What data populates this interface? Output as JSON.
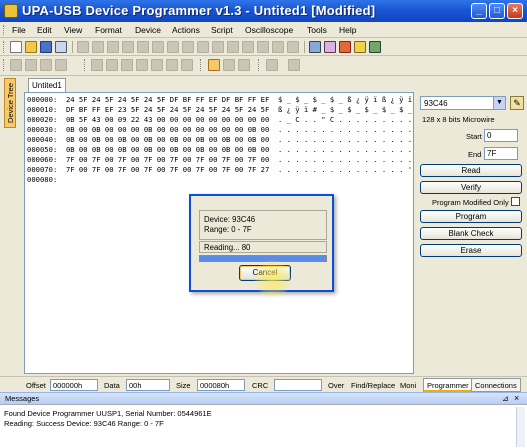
{
  "window": {
    "title": "UPA-USB Device Programmer v1.3 - Untited1 [Modified]"
  },
  "menubar": [
    "File",
    "Edit",
    "View",
    "Format",
    "Device",
    "Actions",
    "Script",
    "Oscilloscope",
    "Tools",
    "Help"
  ],
  "sidebar": {
    "tab_label": "Device Tree"
  },
  "document": {
    "tab": "Untited1",
    "hex_lines": [
      "000000:  24 5F 24 5F 24 5F 24 5F DF BF FF EF DF BF FF EF  $ _ $ _ $ _ $ _ ß ¿ ÿ ï ß ¿ ÿ ï",
      "000010:  DF BF FF EF 23 5F 24 5F 24 5F 24 5F 24 5F 24 5F  ß ¿ ÿ ï # _ $ _ $ _ $ _ $ _ $ _",
      "000020:  0B 5F 43 00 09 22 43 00 00 00 00 00 00 00 00 00  . _ C . . \" C . . . . . . . . .",
      "000030:  0B 00 0B 00 00 00 0B 00 00 00 00 00 00 00 0B 00  . . . . . . . . . . . . . . . .",
      "000040:  0B 00 0B 00 0B 00 0B 00 0B 00 0B 00 0B 00 0B 00  . . . . . . . . . . . . . . . .",
      "000050:  0B 00 0B 00 0B 00 0B 00 0B 00 0B 00 0B 00 0B 00  . . . . . . . . . . . . . . . .",
      "000060:  7F 00 7F 00 7F 00 7F 00 7F 00 7F 00 7F 00 7F 00  . . . . . . . . . . . . . . . .",
      "000070:  7F 00 7F 00 7F 00 7F 00 7F 00 7F 00 7F 00 7F 27  . . . . . . . . . . . . . . . '",
      "000080:"
    ]
  },
  "device_panel": {
    "chip": "93C46",
    "description": "128 x 8 bits Microwire",
    "start_label": "Start",
    "start_value": "0",
    "end_label": "End",
    "end_value": "7F",
    "read_button": "Read",
    "verify_button": "Verify",
    "program_modified_only": "Program Modified Only",
    "program_button": "Program",
    "blank_check_button": "Blank Check",
    "erase_button": "Erase"
  },
  "statusbar": {
    "offset_label": "Offset",
    "offset_value": "000000h",
    "data_label": "Data",
    "data_value": "00h",
    "size_label": "Size",
    "size_value": "000080h",
    "crc_label": "CRC",
    "over_label": "Over",
    "find_replace_label": "Find/Replace",
    "moni_label": "Moni",
    "tab_programmer": "Programmer",
    "tab_connections": "Connections"
  },
  "messages": {
    "header": "Messages",
    "lines": [
      "Found Device Programmer UUSP1, Serial Number: 0544961E",
      "Reading: Success  Device: 93C46 Range: 0 - 7F"
    ]
  },
  "dialog": {
    "device_line": "Device: 93C46",
    "range_line": "Range: 0 - 7F",
    "status_line": "Reading... 80",
    "progress": 1.0,
    "cancel_button": "Cancel"
  },
  "colors": {
    "titlebar": "#1a56d4",
    "dialog_border": "#0a4fd6",
    "progress_fill": "#5a8be8",
    "sidebar_tab": "#f7c96b"
  }
}
